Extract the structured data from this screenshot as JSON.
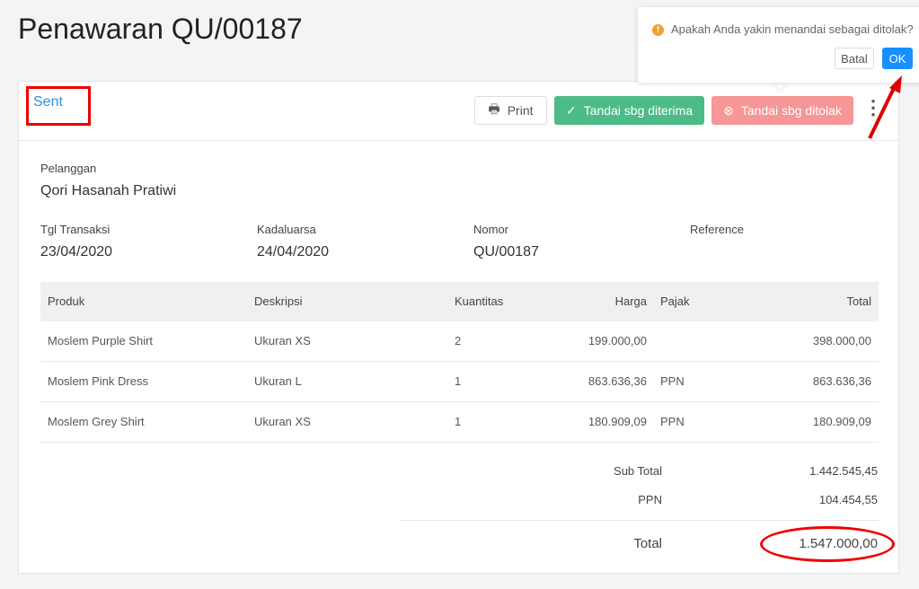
{
  "page": {
    "title": "Penawaran QU/00187"
  },
  "status": "Sent",
  "toolbar": {
    "print": "Print",
    "accept": "Tandai sbg diterima",
    "reject": "Tandai sbg ditolak",
    "more_icon": "kebab-icon"
  },
  "fields": {
    "customer_label": "Pelanggan",
    "customer": "Qori Hasanah Pratiwi",
    "date_label": "Tgl Transaksi",
    "date": "23/04/2020",
    "expiry_label": "Kadaluarsa",
    "expiry": "24/04/2020",
    "number_label": "Nomor",
    "number": "QU/00187",
    "reference_label": "Reference",
    "reference": ""
  },
  "table": {
    "headers": [
      "Produk",
      "Deskripsi",
      "Kuantitas",
      "Harga",
      "Pajak",
      "Total"
    ],
    "rows": [
      [
        "Moslem Purple Shirt",
        "Ukuran XS",
        "2",
        "199.000,00",
        "",
        "398.000,00"
      ],
      [
        "Moslem Pink Dress",
        "Ukuran L",
        "1",
        "863.636,36",
        "PPN",
        "863.636,36"
      ],
      [
        "Moslem Grey Shirt",
        "Ukuran XS",
        "1",
        "180.909,09",
        "PPN",
        "180.909,09"
      ]
    ]
  },
  "totals": {
    "subtotal_label": "Sub Total",
    "subtotal": "1.442.545,45",
    "tax_label": "PPN",
    "tax": "104.454,55",
    "total_label": "Total",
    "total": "1.547.000,00"
  },
  "popup": {
    "message": "Apakah Anda yakin menandai sebagai ditolak?",
    "cancel": "Batal",
    "ok": "OK"
  },
  "colors": {
    "accept": "#4cbb87",
    "reject": "#f69696",
    "ok": "#1890ff",
    "status": "#2f8fdd",
    "annotation": "#e00000"
  }
}
